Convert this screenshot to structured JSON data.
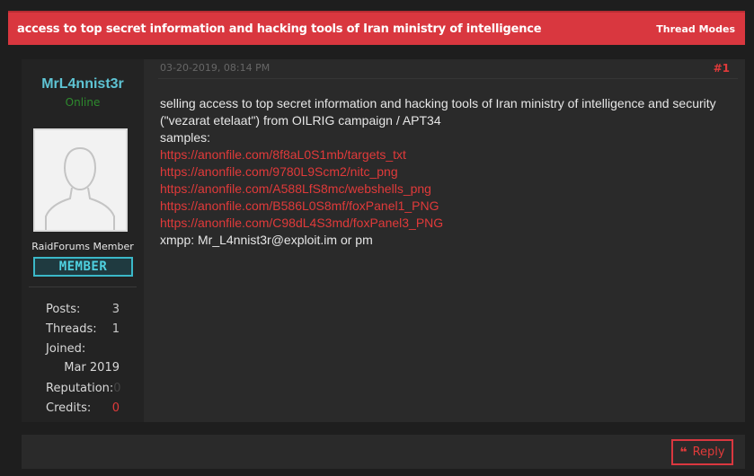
{
  "thread": {
    "title": "access to top secret information and hacking tools of Iran ministry of intelligence",
    "modes_label": "Thread Modes"
  },
  "user": {
    "username": "MrL4nnist3r",
    "status": "Online",
    "title": "RaidForums Member",
    "rank": "MEMBER",
    "stats": {
      "posts_label": "Posts:",
      "posts": "3",
      "threads_label": "Threads:",
      "threads": "1",
      "joined_label": "Joined:",
      "joined": "Mar 2019",
      "reputation_label": "Reputation:",
      "reputation": "0",
      "credits_label": "Credits:",
      "credits": "0"
    }
  },
  "post": {
    "date": "03-20-2019, 08:14 PM",
    "number": "#1",
    "intro": "selling access to top secret information and hacking tools of Iran ministry of intelligence and security (\"vezarat etelaat\") from OILRIG campaign / APT34",
    "samples_label": "samples:",
    "links": [
      "https://anonfile.com/8f8aL0S1mb/targets_txt",
      "https://anonfile.com/9780L9Scm2/nitc_png",
      "https://anonfile.com/A588LfS8mc/webshells_png",
      "https://anonfile.com/B586L0S8mf/foxPanel1_PNG",
      "https://anonfile.com/C98dL4S3md/foxPanel3_PNG"
    ],
    "contact": "xmpp: Mr_L4nnist3r@exploit.im or pm"
  },
  "footer": {
    "reply_label": "Reply",
    "quote_icon": "quote-icon"
  },
  "colors": {
    "accent_red": "#d9373f",
    "username_cyan": "#5ec4d4",
    "online_green": "#2e8b2e",
    "link_red": "#e03a3a"
  }
}
